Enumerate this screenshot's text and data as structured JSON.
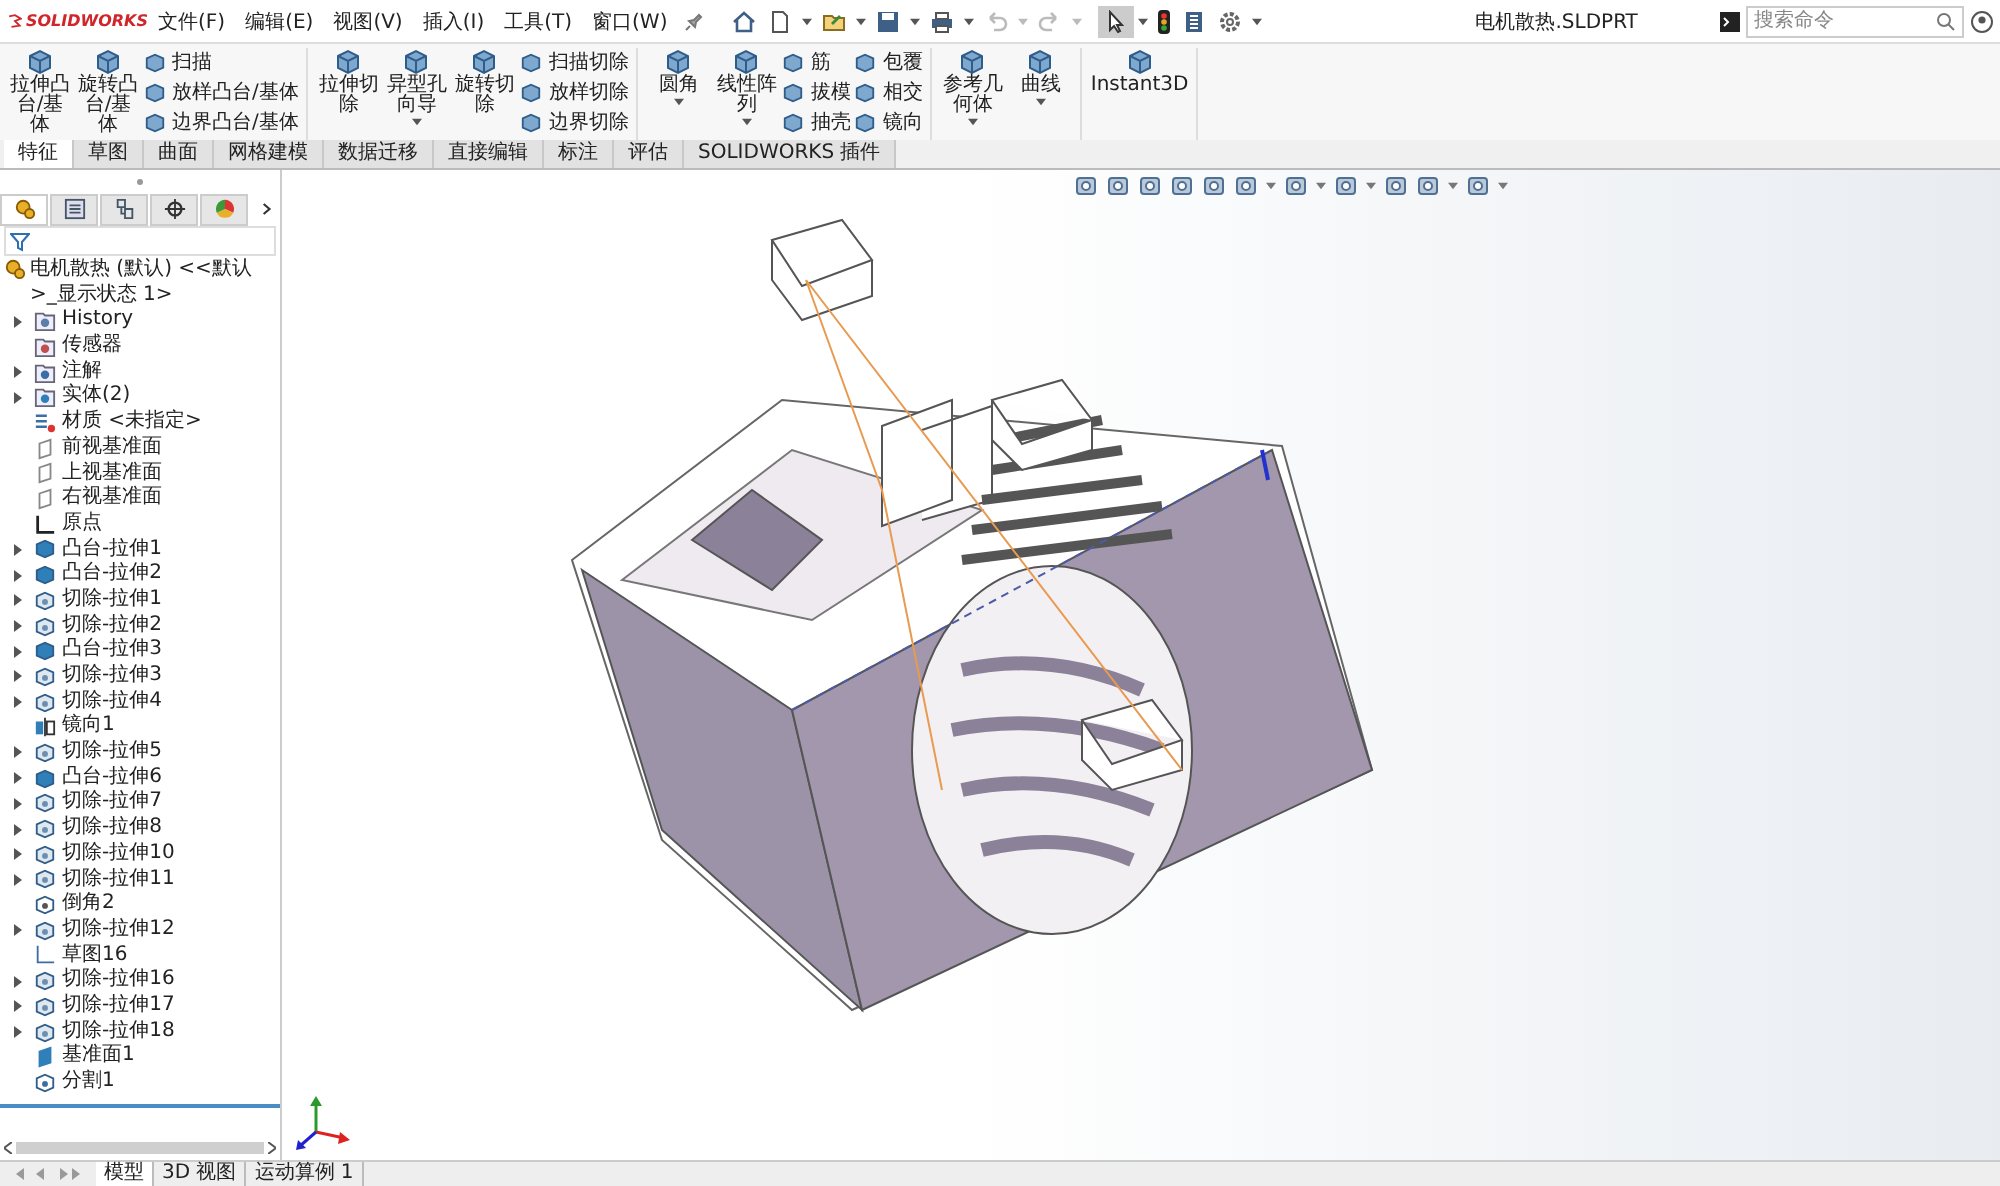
{
  "menubar": {
    "logo": "SOLIDWORKS",
    "menus": [
      "文件(F)",
      "编辑(E)",
      "视图(V)",
      "插入(I)",
      "工具(T)",
      "窗口(W)"
    ],
    "title": "电机散热.SLDPRT",
    "search": {
      "placeholder": "搜索命令"
    }
  },
  "command_groups": [
    {
      "items": [
        {
          "kind": "large",
          "label": "拉伸凸台/基体",
          "dropdown": false
        },
        {
          "kind": "large",
          "label": "旋转凸台/基体",
          "dropdown": false
        },
        {
          "kind": "column",
          "entries": [
            "扫描",
            "放样凸台/基体",
            "边界凸台/基体"
          ]
        }
      ]
    },
    {
      "items": [
        {
          "kind": "large",
          "label": "拉伸切除",
          "dropdown": false
        },
        {
          "kind": "large",
          "label": "异型孔向导",
          "dropdown": true
        },
        {
          "kind": "large",
          "label": "旋转切除",
          "dropdown": false
        },
        {
          "kind": "column",
          "entries": [
            "扫描切除",
            "放样切除",
            "边界切除"
          ]
        }
      ]
    },
    {
      "items": [
        {
          "kind": "large",
          "label": "圆角",
          "dropdown": true
        },
        {
          "kind": "large",
          "label": "线性阵列",
          "dropdown": true
        },
        {
          "kind": "column",
          "entries": [
            "筋",
            "拔模",
            "抽壳"
          ]
        },
        {
          "kind": "column",
          "entries": [
            "包覆",
            "相交",
            "镜向"
          ]
        }
      ]
    },
    {
      "items": [
        {
          "kind": "large",
          "label": "参考几何体",
          "dropdown": true
        },
        {
          "kind": "large",
          "label": "曲线",
          "dropdown": true
        }
      ]
    },
    {
      "items": [
        {
          "kind": "large",
          "label": "Instant3D",
          "dropdown": false
        }
      ]
    }
  ],
  "tabs": [
    {
      "label": "特征",
      "selected": true
    },
    {
      "label": "草图",
      "selected": false
    },
    {
      "label": "曲面",
      "selected": false
    },
    {
      "label": "网格建模",
      "selected": false
    },
    {
      "label": "数据迁移",
      "selected": false
    },
    {
      "label": "直接编辑",
      "selected": false
    },
    {
      "label": "标注",
      "selected": false
    },
    {
      "label": "评估",
      "selected": false
    },
    {
      "label": "SOLIDWORKS 插件",
      "selected": false
    }
  ],
  "tree": {
    "root": "电机散热 (默认) <<默认>_显示状态 1>",
    "items": [
      {
        "label": "History",
        "kind": "history",
        "expandable": true
      },
      {
        "label": "传感器",
        "kind": "sensor",
        "expandable": false
      },
      {
        "label": "注解",
        "kind": "annotation",
        "expandable": true
      },
      {
        "label": "实体(2)",
        "kind": "solid",
        "expandable": true
      },
      {
        "label": "材质 <未指定>",
        "kind": "material",
        "expandable": false
      },
      {
        "label": "前视基准面",
        "kind": "plane",
        "expandable": false
      },
      {
        "label": "上视基准面",
        "kind": "plane",
        "expandable": false
      },
      {
        "label": "右视基准面",
        "kind": "plane",
        "expandable": false
      },
      {
        "label": "原点",
        "kind": "origin",
        "expandable": false
      },
      {
        "label": "凸台-拉伸1",
        "kind": "boss",
        "expandable": true
      },
      {
        "label": "凸台-拉伸2",
        "kind": "boss",
        "expandable": true
      },
      {
        "label": "切除-拉伸1",
        "kind": "cut",
        "expandable": true
      },
      {
        "label": "切除-拉伸2",
        "kind": "cut",
        "expandable": true
      },
      {
        "label": "凸台-拉伸3",
        "kind": "boss",
        "expandable": true
      },
      {
        "label": "切除-拉伸3",
        "kind": "cut",
        "expandable": true
      },
      {
        "label": "切除-拉伸4",
        "kind": "cut",
        "expandable": true
      },
      {
        "label": "镜向1",
        "kind": "mirror",
        "expandable": false
      },
      {
        "label": "切除-拉伸5",
        "kind": "cut",
        "expandable": true
      },
      {
        "label": "凸台-拉伸6",
        "kind": "boss",
        "expandable": true
      },
      {
        "label": "切除-拉伸7",
        "kind": "cut",
        "expandable": true
      },
      {
        "label": "切除-拉伸8",
        "kind": "cut",
        "expandable": true
      },
      {
        "label": "切除-拉伸10",
        "kind": "cut",
        "expandable": true
      },
      {
        "label": "切除-拉伸11",
        "kind": "cut",
        "expandable": true
      },
      {
        "label": "倒角2",
        "kind": "chamfer",
        "expandable": false
      },
      {
        "label": "切除-拉伸12",
        "kind": "cut",
        "expandable": true
      },
      {
        "label": "草图16",
        "kind": "sketch",
        "expandable": false
      },
      {
        "label": "切除-拉伸16",
        "kind": "cut",
        "expandable": true
      },
      {
        "label": "切除-拉伸17",
        "kind": "cut",
        "expandable": true
      },
      {
        "label": "切除-拉伸18",
        "kind": "cut",
        "expandable": true
      },
      {
        "label": "基准面1",
        "kind": "plane_solid",
        "expandable": false
      },
      {
        "label": "分割1",
        "kind": "split",
        "expandable": false
      }
    ]
  },
  "bottom_tabs": [
    {
      "label": "模型",
      "selected": true
    },
    {
      "label": "3D 视图",
      "selected": false
    },
    {
      "label": "运动算例 1",
      "selected": false
    }
  ]
}
